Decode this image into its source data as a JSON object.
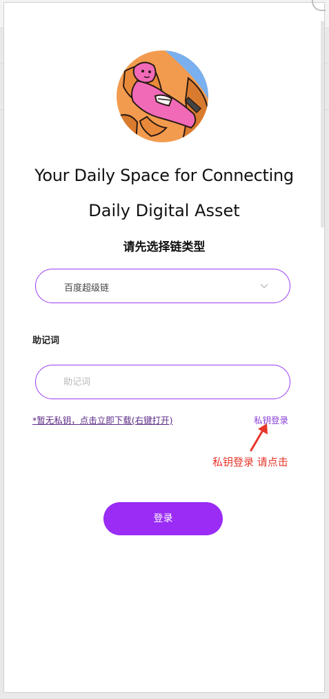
{
  "hero": {
    "line1": "Your Daily Space for Connecting",
    "line2": "Daily Digital Asset"
  },
  "chain": {
    "prompt": "请先选择链类型",
    "selected": "百度超级链"
  },
  "mnemonic": {
    "label": "助记词",
    "placeholder": "助记词",
    "value": ""
  },
  "links": {
    "download": "*暂无私钥，点击立即下载(右键打开)",
    "private_key_login": "私钥登录"
  },
  "annotation": {
    "text": "私钥登录 请点击"
  },
  "login_button": "登录",
  "colors": {
    "accent": "#9a2cf5",
    "annotation": "#e8352b"
  },
  "icons": {
    "avatar": "avatar-illustration",
    "dropdown": "chevron-down-icon",
    "annotation_arrow": "arrow-icon"
  }
}
